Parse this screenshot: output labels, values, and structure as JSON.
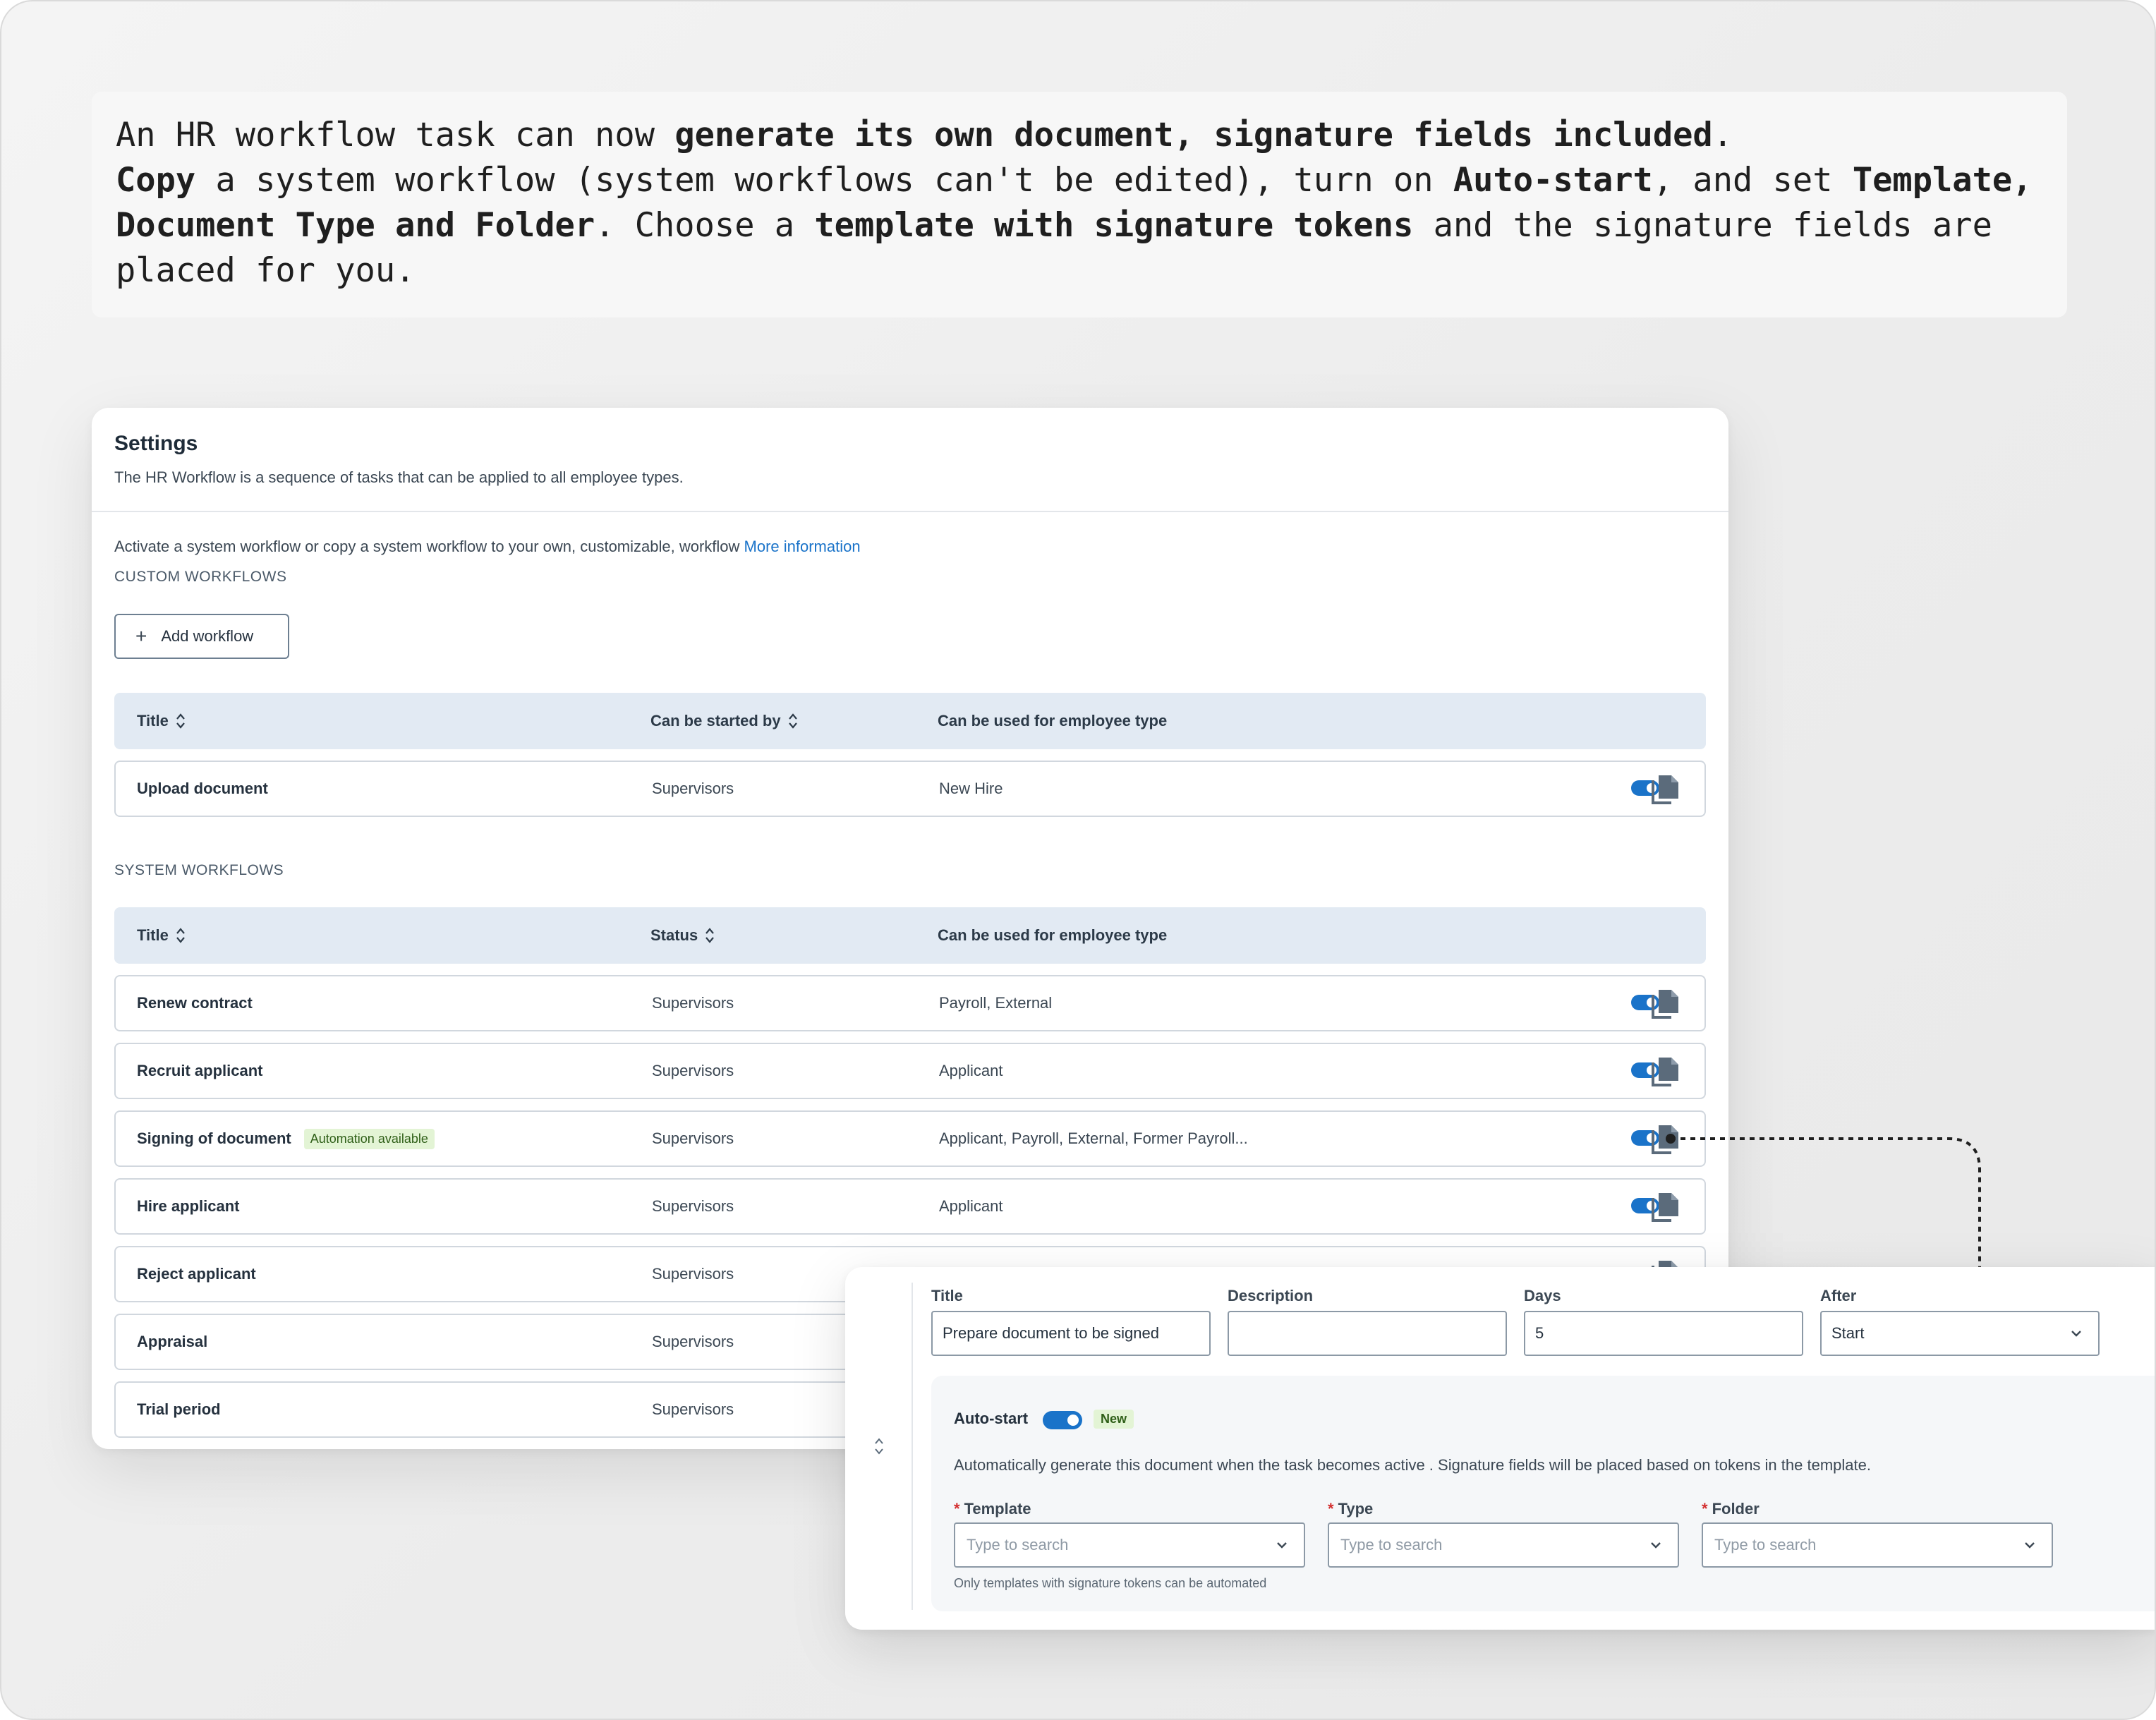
{
  "callout": {
    "part1": "An HR workflow task can now ",
    "bold1": "generate its own document, signature fields included",
    "part2": ".",
    "bold2": "Copy",
    "part3": " a system workflow (system workflows can't be edited), turn on ",
    "bold3": "Auto-start",
    "part4": ", and set ",
    "bold4": "Template, Document Type and Folder",
    "part5": ". Choose a ",
    "bold5": "template with signature tokens",
    "part6": " and the signature fields are placed for you."
  },
  "settings": {
    "title": "Settings",
    "subtitle": "The HR Workflow is a sequence of tasks that can be applied to all employee types.",
    "intro_text": "Activate a system workflow or copy a system workflow to your own, customizable, workflow ",
    "intro_link": "More information",
    "custom_section_label": "CUSTOM WORKFLOWS",
    "add_workflow_label": "Add workflow",
    "custom_table": {
      "headers": [
        "Title",
        "Can be started by",
        "Can be used for employee type"
      ],
      "rows": [
        {
          "title": "Upload document",
          "started_by": "Supervisors",
          "employee_type": "New Hire",
          "enabled": true
        }
      ]
    },
    "system_section_label": "SYSTEM  WORKFLOWS",
    "system_table": {
      "headers": [
        "Title",
        "Status",
        "Can be used for employee type"
      ],
      "rows": [
        {
          "title": "Renew contract",
          "status": "Supervisors",
          "employee_type": "Payroll, External",
          "enabled": true
        },
        {
          "title": "Recruit applicant",
          "status": "Supervisors",
          "employee_type": "Applicant",
          "enabled": true
        },
        {
          "title": "Signing of document",
          "badge": "Automation available",
          "status": "Supervisors",
          "employee_type": "Applicant, Payroll, External, Former Payroll...",
          "enabled": true
        },
        {
          "title": "Hire applicant",
          "status": "Supervisors",
          "employee_type": "Applicant",
          "enabled": true
        },
        {
          "title": "Reject applicant",
          "status": "Supervisors",
          "employee_type": "",
          "enabled": true
        },
        {
          "title": "Appraisal",
          "status": "Supervisors",
          "employee_type": "",
          "enabled": true
        },
        {
          "title": "Trial period",
          "status": "Supervisors",
          "employee_type": "",
          "enabled": true
        }
      ]
    }
  },
  "task": {
    "title_label": "Title",
    "title_value": "Prepare document to be signed",
    "description_label": "Description",
    "description_value": "",
    "days_label": "Days",
    "days_value": "5",
    "after_label": "After",
    "after_value": "Start",
    "auto_start_label": "Auto-start",
    "auto_start_enabled": true,
    "new_badge": "New",
    "auto_description": "Automatically generate this document when the task becomes active . Signature fields will be placed based on tokens in the template.",
    "template_label": "Template",
    "type_label": "Type",
    "folder_label": "Folder",
    "search_placeholder": "Type to search",
    "template_help": "Only templates with signature tokens can be automated"
  },
  "colors": {
    "accent": "#1a73c9",
    "badge_bg": "#e3f4d5",
    "table_header_bg": "#e2eaf3",
    "required": "#d32f2f"
  },
  "icons": {
    "copy": "copy-document-icon",
    "sort": "sort-icon",
    "chevron": "chevron-down-icon",
    "drag": "drag-handle-icon",
    "add": "plus-icon"
  }
}
